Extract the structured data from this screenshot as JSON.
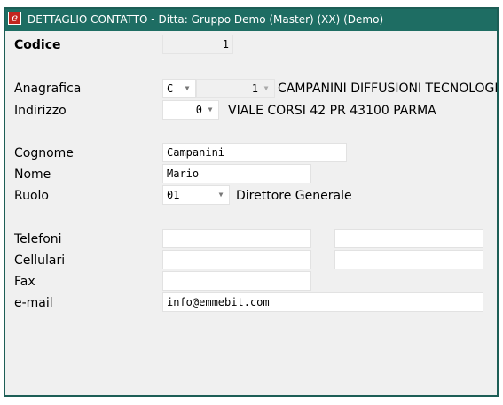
{
  "window": {
    "title": "DETTAGLIO CONTATTO - Ditta: Gruppo Demo (Master) (XX)  (Demo)",
    "icon": "e-app-icon",
    "accent_color": "#1e6d63"
  },
  "form": {
    "codice": {
      "label": "Codice",
      "value": "1"
    },
    "anagrafica": {
      "label": "Anagrafica",
      "type_value": "C",
      "code_value": "1",
      "description": "CAMPANINI DIFFUSIONI TECNOLOGICHE"
    },
    "indirizzo": {
      "label": "Indirizzo",
      "value": "0",
      "description": "VIALE CORSI 42  PR 43100 PARMA"
    },
    "cognome": {
      "label": "Cognome",
      "value": "Campanini"
    },
    "nome": {
      "label": "Nome",
      "value": "Mario"
    },
    "ruolo": {
      "label": "Ruolo",
      "value": "01",
      "description": "Direttore Generale"
    },
    "telefoni": {
      "label": "Telefoni",
      "value1": "",
      "value2": ""
    },
    "cellulari": {
      "label": "Cellulari",
      "value1": "",
      "value2": ""
    },
    "fax": {
      "label": "Fax",
      "value": ""
    },
    "email": {
      "label": "e-mail",
      "value": "info@emmebit.com"
    }
  }
}
